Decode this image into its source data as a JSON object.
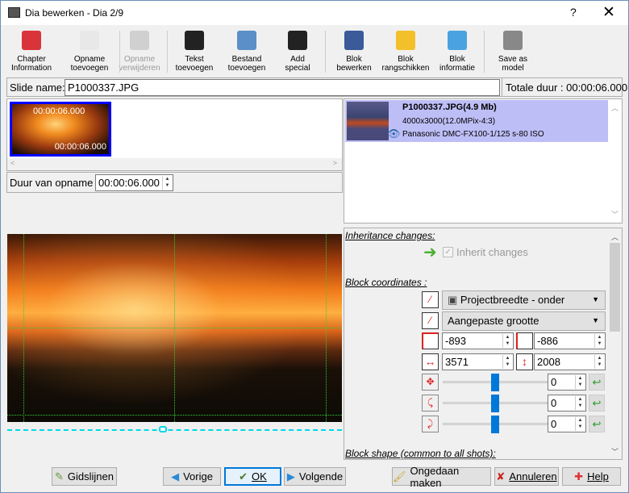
{
  "window": {
    "title": "Dia bewerken - Dia 2/9",
    "help": "?",
    "close": "✕"
  },
  "toolbar": [
    {
      "l1": "Chapter",
      "l2": "Information",
      "icon": "chapter-icon",
      "color": "#d9343a",
      "enabled": true
    },
    {
      "l1": "Opname",
      "l2": "toevoegen",
      "icon": "add-shot-icon",
      "color": "#e8e8e8",
      "enabled": true
    },
    {
      "l1": "Opname",
      "l2": "verwijderen",
      "icon": "delete-shot-icon",
      "color": "#d0d0d0",
      "enabled": false
    },
    {
      "l1": "Tekst",
      "l2": "toevoegen",
      "icon": "add-text-icon",
      "color": "#222222",
      "enabled": true
    },
    {
      "l1": "Bestand",
      "l2": "toevoegen",
      "icon": "add-file-icon",
      "color": "#5b8fc7",
      "enabled": true
    },
    {
      "l1": "Add",
      "l2": "special",
      "icon": "magic-hat-icon",
      "color": "#222222",
      "enabled": true
    },
    {
      "l1": "Blok",
      "l2": "bewerken",
      "icon": "pen-icon",
      "color": "#3a5a9a",
      "enabled": true
    },
    {
      "l1": "Blok",
      "l2": "rangschikken",
      "icon": "arrange-icon",
      "color": "#f2c02a",
      "enabled": true
    },
    {
      "l1": "Blok",
      "l2": "informatie",
      "icon": "info-magnifier-icon",
      "color": "#4aa3df",
      "enabled": true
    },
    {
      "l1": "Save as",
      "l2": "model",
      "icon": "database-icon",
      "color": "#888888",
      "enabled": true
    }
  ],
  "slide": {
    "name_label": "Slide name:",
    "name_value": "P1000337.JPG",
    "total_label": "Totale duur : 00:00:06.000"
  },
  "shots": {
    "thumb_start": "00:00:06.000",
    "thumb_end": "00:00:06.000",
    "duration_label": "Duur van opname :",
    "duration_value": "00:00:06.000"
  },
  "info": {
    "file": "P1000337.JPG(4.9 Mb)",
    "resolution": "4000x3000(12.0MPix-4:3)",
    "camera": "Panasonic DMC-FX100-1/125 s-80 ISO"
  },
  "settings": {
    "inheritance_label": "Inheritance changes:",
    "inherit_checkbox": "Inherit changes",
    "coords_label": "Block coordinates :",
    "combo1": "Projectbreedte - onder",
    "combo2": "Aangepaste grootte",
    "x": "-893",
    "y": "-886",
    "w": "3571",
    "h": "2008",
    "rot_z": "0",
    "rot_x": "0",
    "rot_y": "0",
    "shape_label": "Block shape (common to all shots):"
  },
  "buttons": {
    "guides": "Gidslijnen",
    "prev": "Vorige",
    "ok": "OK",
    "next": "Volgende",
    "undo": "Ongedaan maken",
    "cancel": "Annuleren",
    "help": "Help"
  }
}
